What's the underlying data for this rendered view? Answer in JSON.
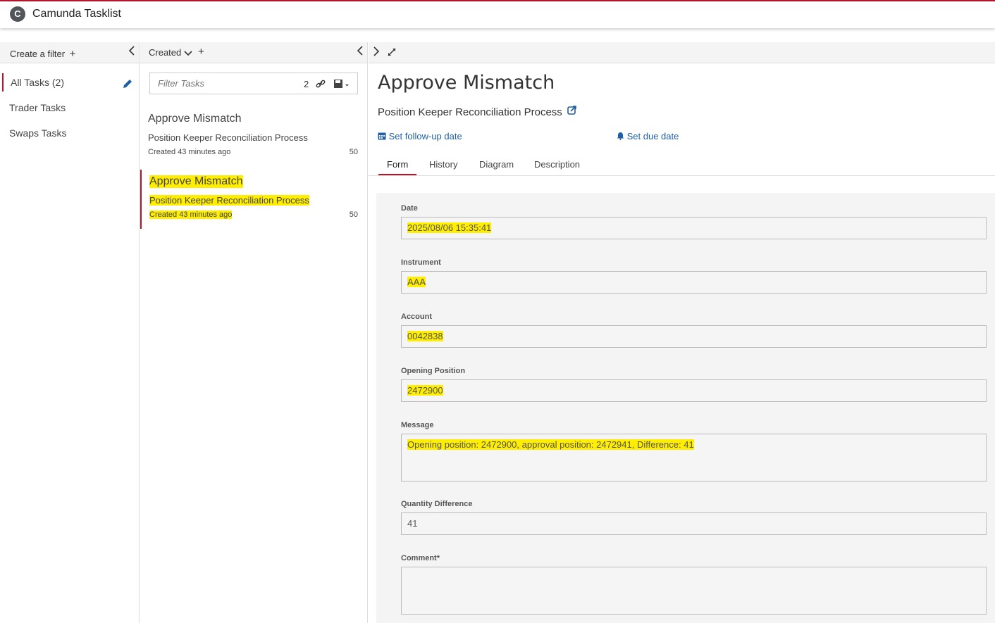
{
  "app": {
    "title": "Camunda Tasklist",
    "logo": "C"
  },
  "filters": {
    "create_label": "Create a filter",
    "plus": "+",
    "collapse": "‹",
    "items": [
      {
        "label": "All Tasks (2)",
        "active": true
      },
      {
        "label": "Trader Tasks"
      },
      {
        "label": "Swaps Tasks"
      }
    ]
  },
  "tasklist": {
    "sort_label": "Created",
    "add": "+",
    "collapse": "‹",
    "search_placeholder": "Filter Tasks",
    "search_count": "2",
    "tasks": [
      {
        "name": "Approve Mismatch",
        "process": "Position Keeper Reconciliation Process",
        "created": "Created 43 minutes ago",
        "priority": "50"
      },
      {
        "name": "Approve Mismatch",
        "process": "Position Keeper Reconciliation Process",
        "created": "Created 43 minutes ago",
        "priority": "50"
      }
    ]
  },
  "detail": {
    "expand": "›",
    "title": "Approve Mismatch",
    "process": "Position Keeper Reconciliation Process",
    "followup": "Set follow-up date",
    "due": "Set due date",
    "tabs": [
      "Form",
      "History",
      "Diagram",
      "Description"
    ],
    "form": {
      "date_label": "Date",
      "date_value": "2025/08/06 15:35:41",
      "instrument_label": "Instrument",
      "instrument_value": "AAA",
      "account_label": "Account",
      "account_value": "0042838",
      "opening_label": "Opening Position",
      "opening_value": "2472900",
      "message_label": "Message",
      "message_value": "Opening position: 2472900, approval position: 2472941, Difference: 41",
      "qty_label": "Quantity Difference",
      "qty_value": "41",
      "comment_label": "Comment*",
      "comment_value": ""
    }
  },
  "colors": {
    "accent": "#b5152b",
    "link": "#1f5fa8",
    "highlight": "#ffee00"
  }
}
